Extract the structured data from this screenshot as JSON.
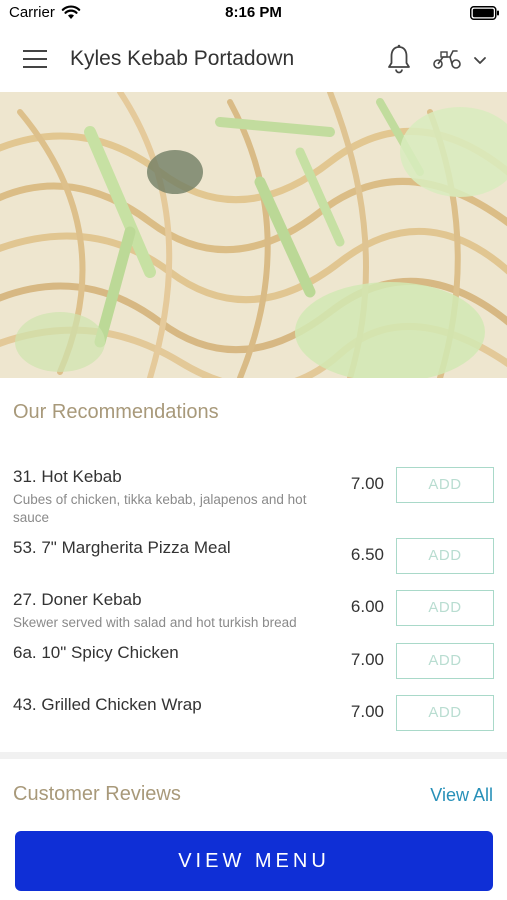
{
  "status_bar": {
    "carrier": "Carrier",
    "time": "8:16 PM"
  },
  "header": {
    "title": "Kyles Kebab Portadown"
  },
  "recommendations": {
    "title": "Our Recommendations",
    "add_label": "ADD",
    "items": [
      {
        "name": "31. Hot Kebab",
        "description": "Cubes of chicken, tikka kebab, jalapenos and hot sauce",
        "price": "7.00"
      },
      {
        "name": "53. 7\" Margherita Pizza Meal",
        "description": "",
        "price": "6.50"
      },
      {
        "name": "27. Doner Kebab",
        "description": "Skewer served with salad and hot turkish bread",
        "price": "6.00"
      },
      {
        "name": "6a. 10\" Spicy Chicken",
        "description": "",
        "price": "7.00"
      },
      {
        "name": "43. Grilled Chicken Wrap",
        "description": "",
        "price": "7.00"
      }
    ]
  },
  "reviews": {
    "title": "Customer Reviews",
    "view_all": "View All"
  },
  "footer": {
    "view_menu": "VIEW MENU"
  },
  "colors": {
    "accent_blue": "#0f2fd6",
    "section_title": "#a8997a",
    "add_border": "#a9d9c9",
    "link": "#2790b8"
  },
  "icons": [
    "wifi-icon",
    "battery-icon",
    "menu-icon",
    "bell-icon",
    "scooter-icon",
    "chevron-down-icon"
  ]
}
